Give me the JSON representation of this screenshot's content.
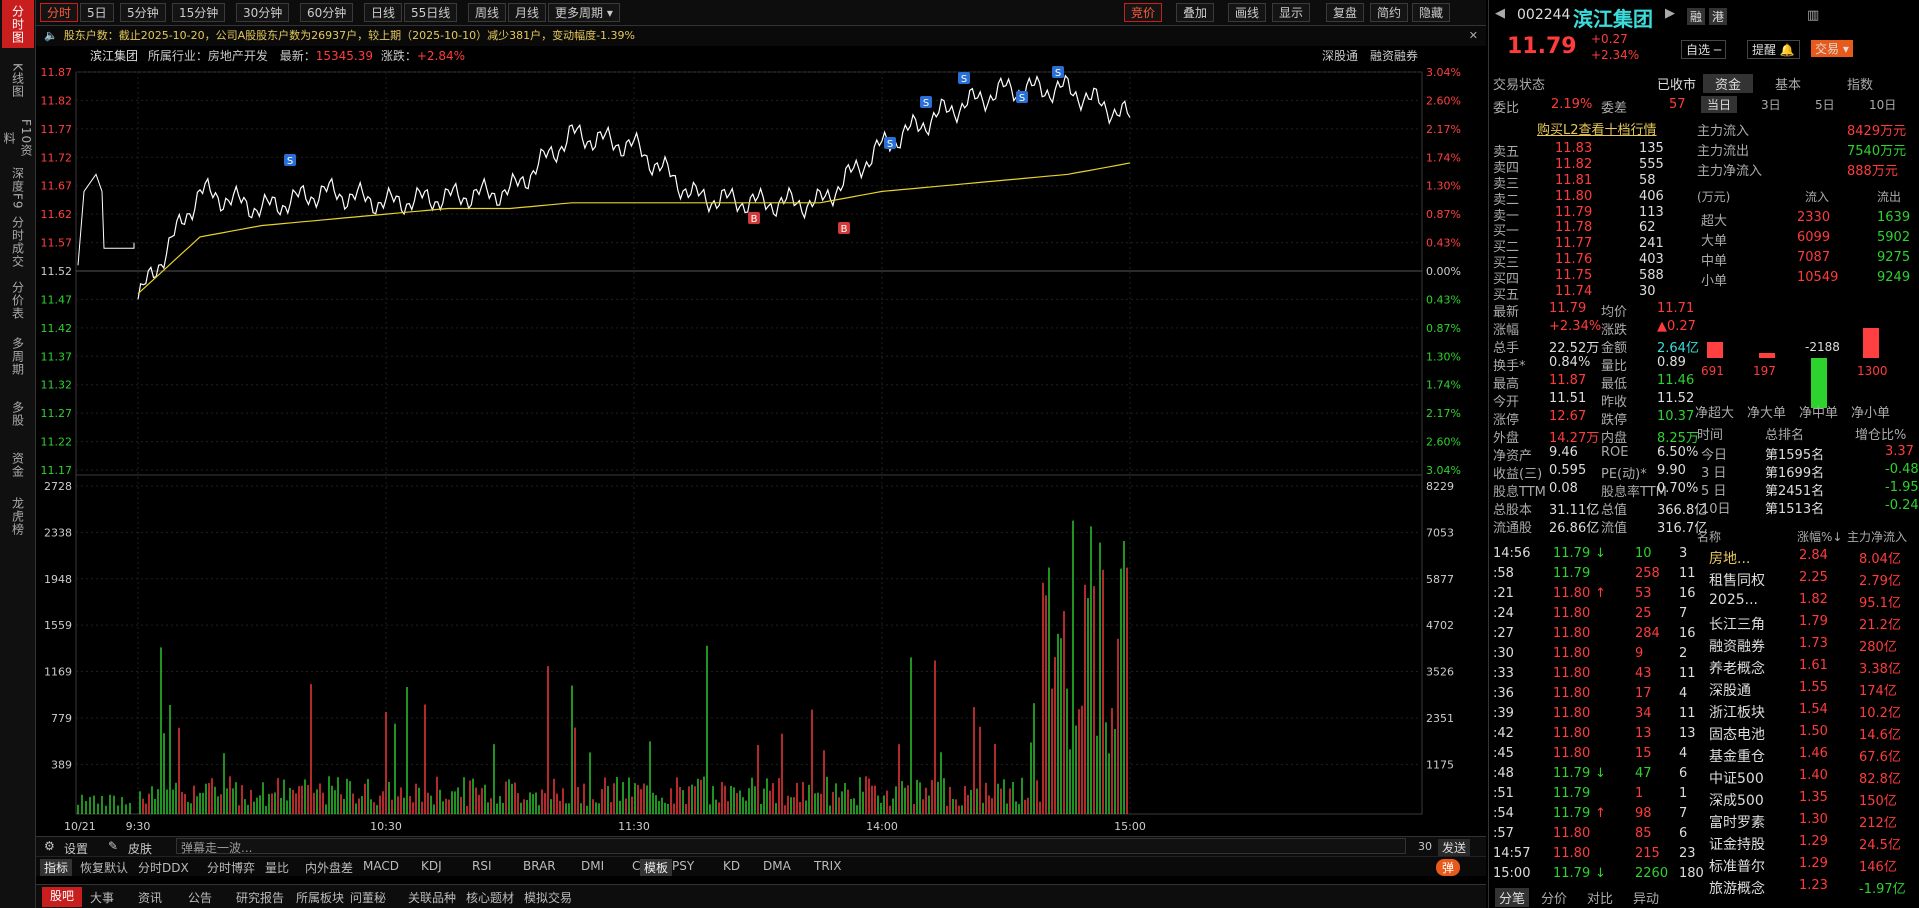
{
  "left_tabs": [
    {
      "label": "分时图",
      "active": true
    },
    {
      "label": "K线图"
    },
    {
      "label": "F10资料"
    },
    {
      "label": "深度F9"
    },
    {
      "label": "分时成交"
    },
    {
      "label": "分价表"
    },
    {
      "label": "多周期"
    },
    {
      "label": "多股"
    },
    {
      "label": "资金"
    },
    {
      "label": "龙虎榜"
    }
  ],
  "toolbar": {
    "periods": [
      "分时",
      "5日",
      "5分钟",
      "15分钟",
      "30分钟",
      "60分钟",
      "日线",
      "55日线",
      "周线",
      "月线",
      "更多周期"
    ],
    "right": [
      "竞价",
      "叠加",
      "画线",
      "显示",
      "复盘",
      "简约",
      "隐藏"
    ]
  },
  "notice": "股东户数：截止2025-10-20，公司A股股东户数为26937户，较上期（2025-10-10）减少381户，变动幅度-1.39%",
  "stockline": {
    "name": "滨江集团",
    "industry_label": "所属行业：",
    "industry": "房地产开发",
    "latest_label": "最新：",
    "latest": "15345.39",
    "change_label": "涨跌：",
    "change": "+2.84%",
    "right1": "深股通",
    "right2": "融资融券"
  },
  "price_axis": [
    "11.87",
    "11.82",
    "11.77",
    "11.72",
    "11.67",
    "11.62",
    "11.57",
    "11.52",
    "11.47",
    "11.42",
    "11.37",
    "11.32",
    "11.27",
    "11.22",
    "11.17"
  ],
  "pct_axis": [
    "3.04%",
    "2.60%",
    "2.17%",
    "1.74%",
    "1.30%",
    "0.87%",
    "0.43%",
    "0.00%",
    "0.43%",
    "0.87%",
    "1.30%",
    "1.74%",
    "2.17%",
    "2.60%",
    "3.04%"
  ],
  "vol_axis_left": [
    "2728",
    "2338",
    "1948",
    "1559",
    "1169",
    "779",
    "389"
  ],
  "vol_axis_right": [
    "8229",
    "7053",
    "5877",
    "4702",
    "3526",
    "2351",
    "1175"
  ],
  "time_axis": [
    "10/21",
    "9:30",
    "10:30",
    "11:30",
    "14:00",
    "15:00"
  ],
  "markers": [
    "S",
    "S",
    "S",
    "S",
    "S",
    "S",
    "B",
    "B"
  ],
  "chart_data": {
    "type": "line",
    "title": "",
    "x": [
      "9:30",
      "9:45",
      "10:00",
      "10:15",
      "10:30",
      "10:45",
      "11:00",
      "11:15",
      "11:30",
      "13:15",
      "13:30",
      "13:45",
      "14:00",
      "14:15",
      "14:30",
      "14:45",
      "15:00"
    ],
    "series": [
      {
        "name": "",
        "values": [
          11.47,
          11.66,
          11.63,
          11.66,
          11.64,
          11.65,
          11.66,
          11.76,
          11.74,
          11.65,
          11.64,
          11.64,
          11.74,
          11.8,
          11.84,
          11.84,
          11.79
        ]
      },
      {
        "name": "",
        "values": [
          11.48,
          11.58,
          11.6,
          11.61,
          11.62,
          11.63,
          11.63,
          11.64,
          11.64,
          11.64,
          11.64,
          11.64,
          11.66,
          11.67,
          11.68,
          11.69,
          11.71
        ]
      }
    ],
    "ylim": [
      11.17,
      11.87
    ]
  },
  "bottom": {
    "settings": "设置",
    "skin": "皮肤",
    "danmu": "弹幕走一波...",
    "count": "30",
    "send": "发送"
  },
  "indicators": [
    "指标",
    "恢复默认",
    "分时DDX",
    "分时博弈",
    "量比",
    "内外盘差",
    "MACD",
    "KDJ",
    "RSI",
    "BRAR",
    "DMI",
    "CR",
    "PSY",
    "KD",
    "DMA",
    "TRIX",
    "模板"
  ],
  "danmu_toggle": "弹",
  "footer": [
    "股吧",
    "大事",
    "资讯",
    "公告",
    "研究报告",
    "所属板块",
    "问董秘",
    "关联品种",
    "核心题材",
    "模拟交易"
  ],
  "quote": {
    "code": "002244",
    "name": "滨江集团",
    "price": "11.79",
    "chg": "+0.27",
    "pct": "+2.34%",
    "buttons": [
      "融",
      "港"
    ],
    "btn_zixuan": "自选",
    "btn_tixing": "提醒",
    "btn_jiaoyi": "交易"
  },
  "status": {
    "label": "交易状态",
    "value": "已收市",
    "weibi_l": "委比",
    "weibi": "2.19%",
    "weicha_l": "委差",
    "weicha": "57",
    "l2": "购买L2查看十档行情"
  },
  "asks": [
    [
      "卖五",
      "11.83",
      "135"
    ],
    [
      "卖四",
      "11.82",
      "555"
    ],
    [
      "卖三",
      "11.81",
      "58"
    ],
    [
      "卖二",
      "11.80",
      "406"
    ],
    [
      "卖一",
      "11.79",
      "113"
    ]
  ],
  "bids": [
    [
      "买一",
      "11.78",
      "62"
    ],
    [
      "买二",
      "11.77",
      "241"
    ],
    [
      "买三",
      "11.76",
      "403"
    ],
    [
      "买四",
      "11.75",
      "588"
    ],
    [
      "买五",
      "11.74",
      "30"
    ]
  ],
  "stats": [
    [
      "最新",
      "11.79",
      "均价",
      "11.71"
    ],
    [
      "涨幅",
      "+2.34%",
      "涨跌",
      "▲0.27"
    ],
    [
      "总手",
      "22.52万",
      "金额",
      "2.64亿"
    ],
    [
      "换手*",
      "0.84%",
      "量比",
      "0.89"
    ],
    [
      "最高",
      "11.87",
      "最低",
      "11.46"
    ],
    [
      "今开",
      "11.51",
      "昨收",
      "11.52"
    ],
    [
      "涨停",
      "12.67",
      "跌停",
      "10.37"
    ],
    [
      "外盘",
      "14.27万",
      "内盘",
      "8.25万"
    ],
    [
      "净资产",
      "9.46",
      "ROE",
      "6.50%"
    ],
    [
      "收益(三)",
      "0.595",
      "PE(动)*",
      "9.90"
    ],
    [
      "股息TTM",
      "0.08",
      "股息率TTM",
      "0.70%"
    ],
    [
      "总股本",
      "31.11亿",
      "总值",
      "366.8亿"
    ],
    [
      "流通股",
      "26.86亿",
      "流值",
      "316.7亿"
    ]
  ],
  "ticks": [
    [
      "14:56",
      "11.79",
      "↓",
      "10",
      "3"
    ],
    [
      ":58",
      "11.79",
      "",
      "258",
      "11"
    ],
    [
      ":21",
      "11.80",
      "↑",
      "53",
      "16"
    ],
    [
      ":24",
      "11.80",
      "",
      "25",
      "7"
    ],
    [
      ":27",
      "11.80",
      "",
      "284",
      "16"
    ],
    [
      ":30",
      "11.80",
      "",
      "9",
      "2"
    ],
    [
      ":33",
      "11.80",
      "",
      "43",
      "11"
    ],
    [
      ":36",
      "11.80",
      "",
      "17",
      "4"
    ],
    [
      ":39",
      "11.80",
      "",
      "34",
      "11"
    ],
    [
      ":42",
      "11.80",
      "",
      "13",
      "13"
    ],
    [
      ":45",
      "11.80",
      "",
      "15",
      "4"
    ],
    [
      ":48",
      "11.79",
      "↓",
      "47",
      "6"
    ],
    [
      ":51",
      "11.79",
      "",
      "1",
      "1"
    ],
    [
      ":54",
      "11.79",
      "↑",
      "98",
      "7"
    ],
    [
      ":57",
      "11.80",
      "",
      "85",
      "6"
    ],
    [
      "14:57",
      "11.80",
      "",
      "215",
      "23"
    ],
    [
      "15:00",
      "11.79",
      "↓",
      "2260",
      "180"
    ]
  ],
  "tick_tabs": [
    "分笔",
    "分价",
    "对比",
    "异动"
  ],
  "fund_tabs": [
    "资金",
    "基本",
    "指数"
  ],
  "fund_period": [
    "当日",
    "3日",
    "5日",
    "10日"
  ],
  "fund_main": [
    [
      "主力流入",
      "8429万元"
    ],
    [
      "主力流出",
      "7540万元"
    ],
    [
      "主力净流入",
      "888万元"
    ]
  ],
  "fund_head": [
    "(万元)",
    "流入",
    "流出"
  ],
  "fund_rows": [
    [
      "超大",
      "2330",
      "1639"
    ],
    [
      "大单",
      "6099",
      "5902"
    ],
    [
      "中单",
      "7087",
      "9275"
    ],
    [
      "小单",
      "10549",
      "9249"
    ]
  ],
  "fund_bars": {
    "values": [
      691,
      197,
      -2188,
      1300
    ],
    "labels": [
      "净超大",
      "净大单",
      "净中单",
      "净小单"
    ]
  },
  "rank_head": [
    "时间",
    "总排名",
    "增仓比%"
  ],
  "ranks": [
    [
      "今日",
      "",
      "3.37"
    ],
    [
      "3 日",
      "第1699名",
      "-0.48"
    ],
    [
      "5 日",
      "第2451名",
      "-1.95"
    ],
    [
      "10日",
      "第1513名",
      "-0.24"
    ]
  ],
  "rank_today": "第1595名",
  "sector_head": [
    "名称",
    "涨幅%↓",
    "主力净流入"
  ],
  "sectors": [
    [
      "房地...",
      "2.84",
      "8.04亿"
    ],
    [
      "租售同权",
      "2.25",
      "2.79亿"
    ],
    [
      "2025...",
      "1.82",
      "95.1亿"
    ],
    [
      "长江三角",
      "1.79",
      "21.2亿"
    ],
    [
      "融资融券",
      "1.73",
      "280亿"
    ],
    [
      "养老概念",
      "1.61",
      "3.38亿"
    ],
    [
      "深股通",
      "1.55",
      "174亿"
    ],
    [
      "浙江板块",
      "1.54",
      "10.2亿"
    ],
    [
      "固态电池",
      "1.50",
      "14.6亿"
    ],
    [
      "基金重仓",
      "1.46",
      "67.6亿"
    ],
    [
      "中证500",
      "1.40",
      "82.8亿"
    ],
    [
      "深成500",
      "1.35",
      "150亿"
    ],
    [
      "富时罗素",
      "1.30",
      "212亿"
    ],
    [
      "证金持股",
      "1.29",
      "24.5亿"
    ],
    [
      "标准普尔",
      "1.29",
      "146亿"
    ],
    [
      "旅游概念",
      "1.23",
      "-1.97亿"
    ]
  ]
}
